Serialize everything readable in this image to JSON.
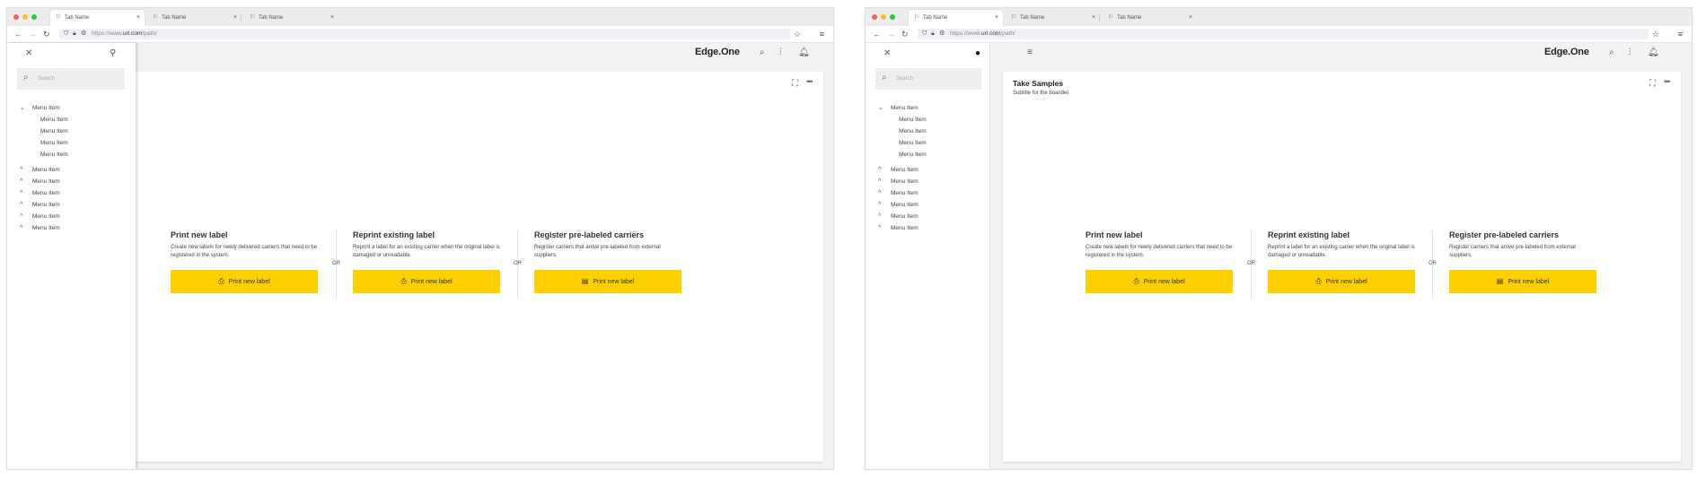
{
  "browser": {
    "tabs": [
      {
        "label": "Tab Name",
        "icon": "page-icon",
        "close": "×"
      },
      {
        "label": "Tab Name",
        "icon": "page-icon",
        "close": "×"
      },
      {
        "label": "Tab Name",
        "icon": "page-icon",
        "close": "×"
      }
    ],
    "url_prefix": "https://www.",
    "url_domain": "url.com",
    "url_path": "/path/",
    "traffic_lights": [
      "#ff5f57",
      "#febc2e",
      "#28c840"
    ],
    "icons": {
      "back": "←",
      "forward": "→",
      "reload": "↻",
      "shield": "⛉",
      "lock": "🔒︎",
      "permissions": "⚙",
      "star": "☆",
      "menu": "≡"
    }
  },
  "app": {
    "brand": "Edge.One",
    "brand_color": "#222222",
    "icons": {
      "search": "⌕",
      "filters": "⫶",
      "bell": "🔔︎",
      "hamburger": "≡"
    }
  },
  "sidebar": {
    "close_icon": "✕",
    "pin_icon": "📍︎",
    "search_placeholder": "Search",
    "groups": [
      {
        "label": "Menu Item",
        "expanded": true,
        "children": [
          "Menu Item",
          "Menu Item",
          "Menu Item",
          "Menu Item"
        ]
      },
      {
        "label": "Menu Item",
        "expanded": false
      },
      {
        "label": "Menu Item",
        "expanded": false
      },
      {
        "label": "Menu Item",
        "expanded": false
      },
      {
        "label": "Menu Item",
        "expanded": false
      },
      {
        "label": "Menu Item",
        "expanded": false
      },
      {
        "label": "Menu Item",
        "expanded": false
      }
    ]
  },
  "board": {
    "title": "Take Samples",
    "subtitle": "Subtitle for the boardlet",
    "expand_icon": "⛶",
    "more_icon": "•••",
    "or_text": "OR",
    "accent_color": "#ffd000",
    "options": [
      {
        "title": "Print new label",
        "description": "Create new labels for newly delivered carriers that need to be registered in the system.",
        "button_label": "Print new label",
        "button_icon": "printer-icon"
      },
      {
        "title": "Reprint existing label",
        "description": "Reprint a label for an existing carrier when the original label is damaged or unreadable.",
        "button_label": "Print new label",
        "button_icon": "printer-icon"
      },
      {
        "title": "Register pre-labeled carriers",
        "description": "Register carriers that arrive pre-labeled from external suppliers,",
        "button_label": "Print new label",
        "button_icon": "register-icon"
      }
    ]
  }
}
